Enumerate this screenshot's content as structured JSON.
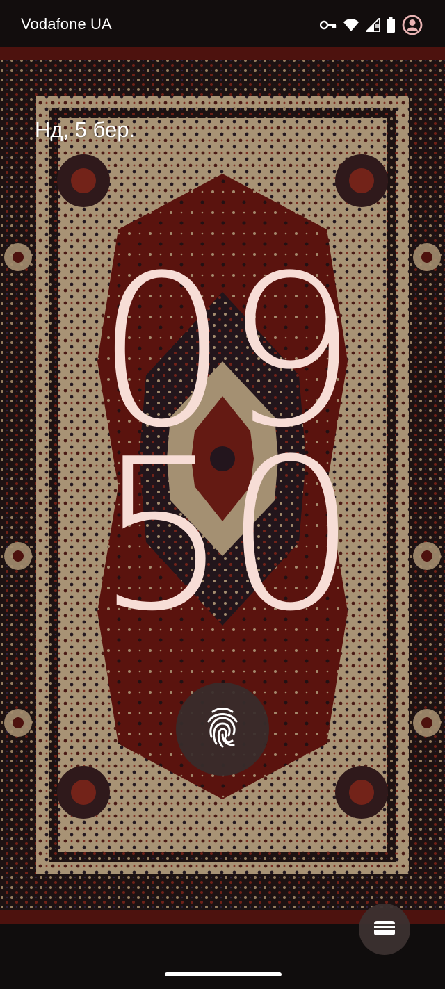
{
  "status_bar": {
    "carrier": "Vodafone UA",
    "icons": [
      "vpn-key-icon",
      "wifi-icon",
      "cellular-signal-icon",
      "battery-icon",
      "account-icon"
    ]
  },
  "lock_screen": {
    "date": "Нд, 5 бер.",
    "clock": {
      "hours": "09",
      "minutes": "50"
    },
    "fingerprint_icon": "fingerprint-icon",
    "wallet_icon": "wallet-icon"
  },
  "colors": {
    "clock": "#f7ddd6",
    "rug_red": "#7a1a14",
    "rug_cream": "#d9c4a3",
    "rug_dark": "#1e1514"
  }
}
